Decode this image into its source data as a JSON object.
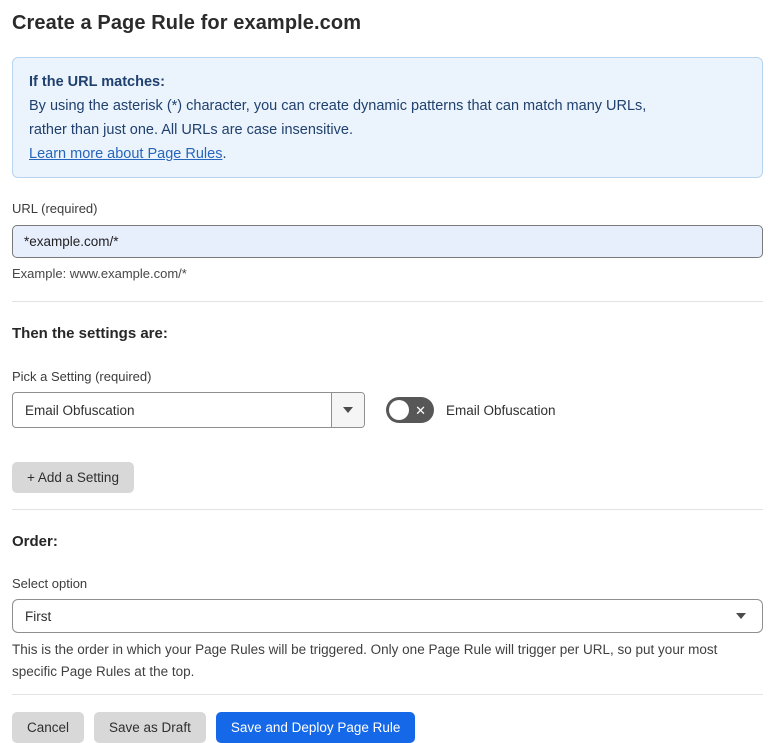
{
  "page": {
    "title": "Create a Page Rule for example.com"
  },
  "info_box": {
    "heading": "If the URL matches:",
    "body_line1": "By using the asterisk (*) character, you can create dynamic patterns that can match many URLs,",
    "body_line2": "rather than just one. All URLs are case insensitive.",
    "link": "Learn more about Page Rules",
    "link_suffix": "."
  },
  "url_field": {
    "label": "URL (required)",
    "value": "*example.com/*",
    "example": "Example: www.example.com/*"
  },
  "settings_section": {
    "heading": "Then the settings are:",
    "picker_label": "Pick a Setting (required)",
    "picker_value": "Email Obfuscation",
    "toggle_label": "Email Obfuscation",
    "toggle_state": "off",
    "toggle_glyph": "✕",
    "add_button": "+ Add a Setting"
  },
  "order_section": {
    "heading": "Order:",
    "select_label": "Select option",
    "select_value": "First",
    "description": "This is the order in which your Page Rules will be triggered. Only one Page Rule will trigger per URL, so put your most specific Page Rules at the top."
  },
  "footer": {
    "cancel": "Cancel",
    "save_draft": "Save as Draft",
    "save_deploy": "Save and Deploy Page Rule"
  },
  "colors": {
    "accent_blue": "#1568e8",
    "callout_bg": "#ebf4fc",
    "callout_border": "#b7d5f0",
    "callout_text": "#20406e",
    "link_blue": "#2765bd",
    "input_bg": "#e7eefc",
    "toggle_off_bg": "#575757",
    "button_gray": "#d8d8d8"
  }
}
